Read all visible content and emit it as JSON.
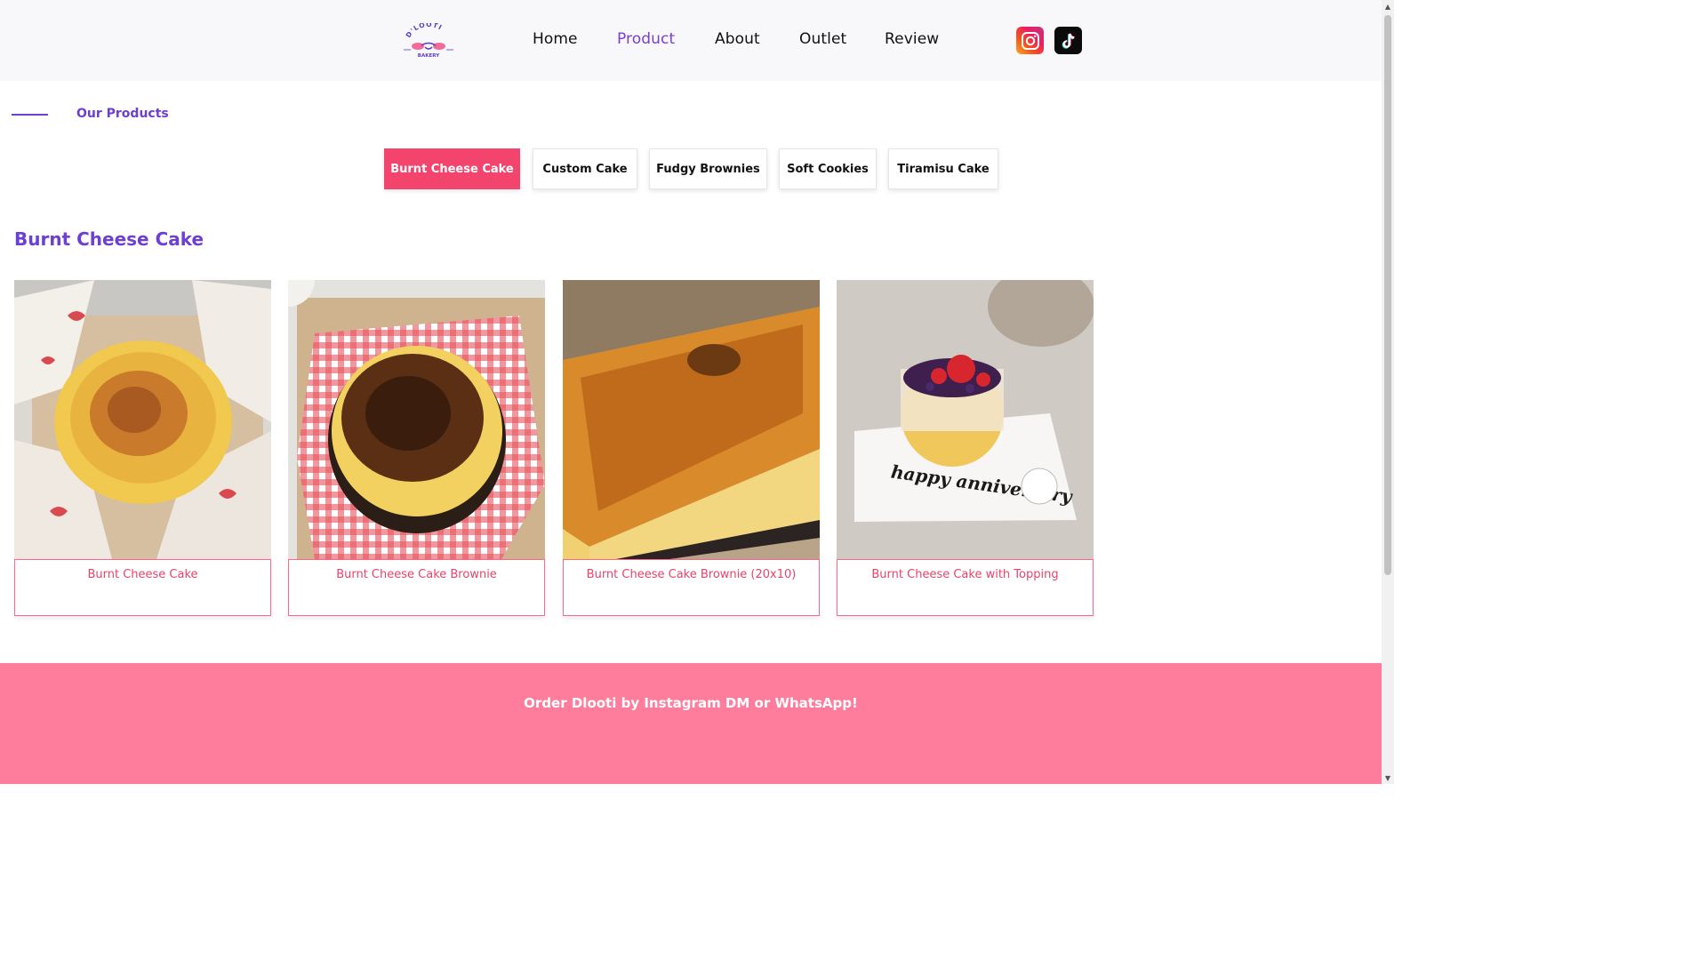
{
  "header": {
    "logo": {
      "brand_text": "D'LOOTI",
      "sub_text": "BAKERY"
    },
    "nav": [
      {
        "label": "Home",
        "active": false
      },
      {
        "label": "Product",
        "active": true
      },
      {
        "label": "About",
        "active": false
      },
      {
        "label": "Outlet",
        "active": false
      },
      {
        "label": "Review",
        "active": false
      }
    ],
    "social": [
      {
        "icon": "instagram-icon"
      },
      {
        "icon": "tiktok-icon"
      }
    ]
  },
  "section": {
    "label": "Our Products"
  },
  "tabs": [
    {
      "label": "Burnt Cheese Cake",
      "active": true
    },
    {
      "label": "Custom Cake",
      "active": false
    },
    {
      "label": "Fudgy Brownies",
      "active": false
    },
    {
      "label": "Soft Cookies",
      "active": false
    },
    {
      "label": "Tiramisu Cake",
      "active": false
    }
  ],
  "category": {
    "title": "Burnt Cheese Cake"
  },
  "products": [
    {
      "name": "Burnt Cheese Cake",
      "image": "burnt-cheese-cake-photo"
    },
    {
      "name": "Burnt Cheese Cake Brownie",
      "image": "burnt-cheese-cake-brownie-photo"
    },
    {
      "name": "Burnt Cheese Cake Brownie (20x10)",
      "image": "burnt-cheese-cake-brownie-20x10-photo"
    },
    {
      "name": "Burnt Cheese Cake with Topping",
      "image": "burnt-cheese-cake-with-topping-photo",
      "cake_text": "happy anniversary"
    }
  ],
  "footer": {
    "text": "Order Dlooti by Instagram DM or WhatsApp!"
  },
  "colors": {
    "accent_purple": "#6d3fd3",
    "nav_active": "#7a3fd1",
    "tab_active": "#f2446d",
    "card_text": "#e8436b",
    "footer_bg": "#fe7c9c"
  }
}
